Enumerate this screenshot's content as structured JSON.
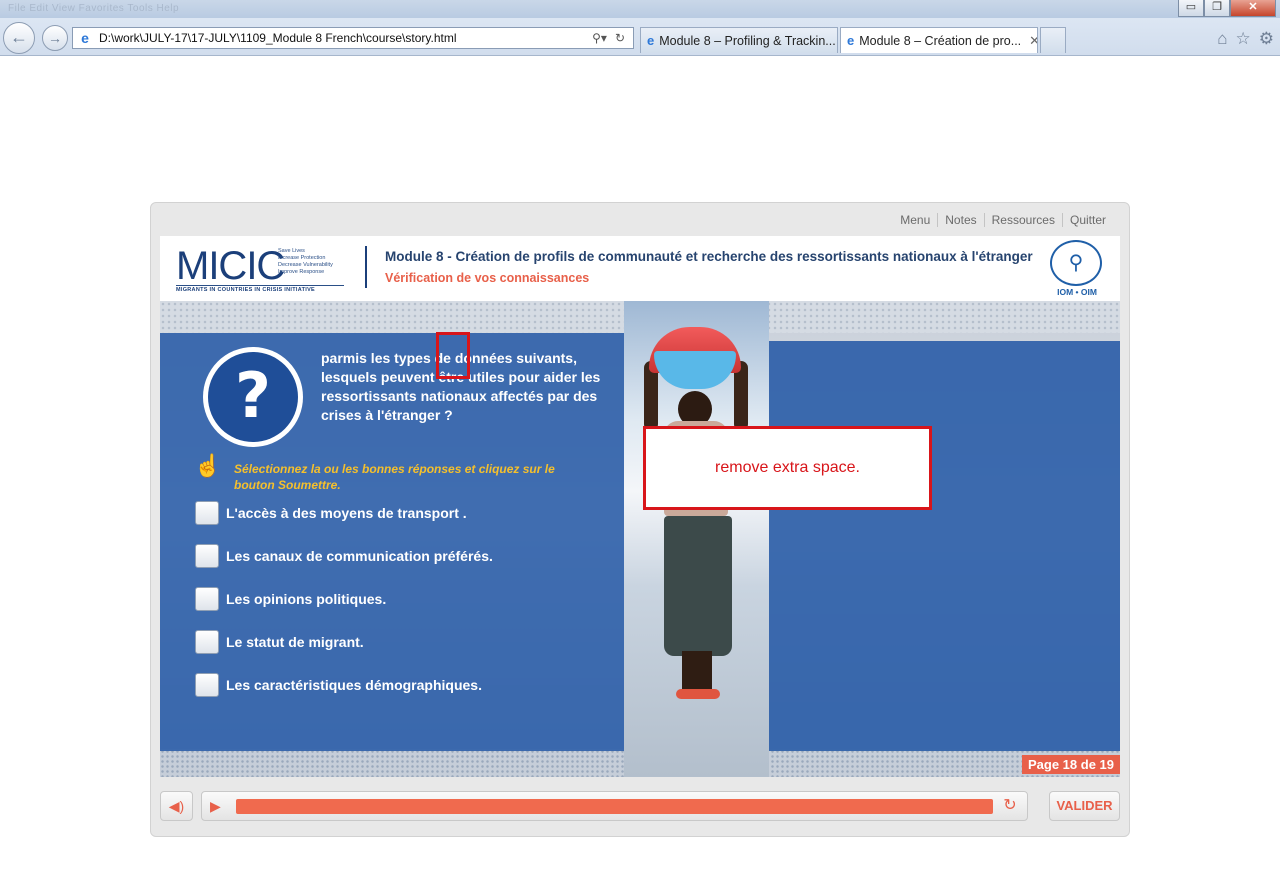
{
  "browser": {
    "menu_ghost": "File  Edit  View  Favorites  Tools  Help",
    "address": "D:\\work\\JULY-17\\17-JULY\\1109_Module 8 French\\course\\story.html",
    "tabs": [
      {
        "label": "Module 8 – Profiling & Trackin..."
      },
      {
        "label": "Module 8 – Création de pro..."
      }
    ],
    "window_controls": {
      "minimize": "▭",
      "restore": "❐",
      "close": "✕"
    }
  },
  "player": {
    "top_links": [
      "Menu",
      "Notes",
      "Ressources",
      "Quitter"
    ],
    "header": {
      "logo_word": "MICIC",
      "logo_tagline": [
        "Save Lives",
        "Increase Protection",
        "Decrease Vulnerability",
        "Improve Response"
      ],
      "logo_subline": "MIGRANTS IN COUNTRIES IN CRISIS INITIATIVE",
      "module_title": "Module 8 - Création de profils de communauté et recherche des ressortissants nationaux à l'étranger",
      "module_subtitle": "Vérification de vos connaissances",
      "iom_text": "IOM • OIM"
    },
    "question": {
      "text": "parmis les types de  données suivants, lesquels peuvent être utiles pour aider les ressortissants nationaux affectés par des crises à l'étranger ?",
      "instruction": "Sélectionnez la ou les bonnes réponses et cliquez sur le bouton Soumettre.",
      "options": [
        {
          "label": "L'accès à des moyens de transport ."
        },
        {
          "label": "Les canaux de communication préférés."
        },
        {
          "label": "Les opinions politiques."
        },
        {
          "label": "Le statut de migrant."
        },
        {
          "label": "Les caractéristiques démographiques."
        }
      ]
    },
    "page_indicator": "Page 18 de 19",
    "controls": {
      "submit_label": "VALIDER",
      "progress": 1.0
    }
  },
  "annotation": {
    "note": "remove extra space."
  },
  "colors": {
    "accent": "#e8604a",
    "panel_blue": "#3262aa",
    "annotation_red": "#d8151a",
    "instruction_yellow": "#f5c02c"
  },
  "icons": {
    "back": "back-arrow-icon",
    "forward": "forward-arrow-icon",
    "question": "question-mark-icon",
    "hand": "tap-hand-icon",
    "volume": "volume-icon",
    "play": "play-icon",
    "replay": "replay-icon"
  }
}
